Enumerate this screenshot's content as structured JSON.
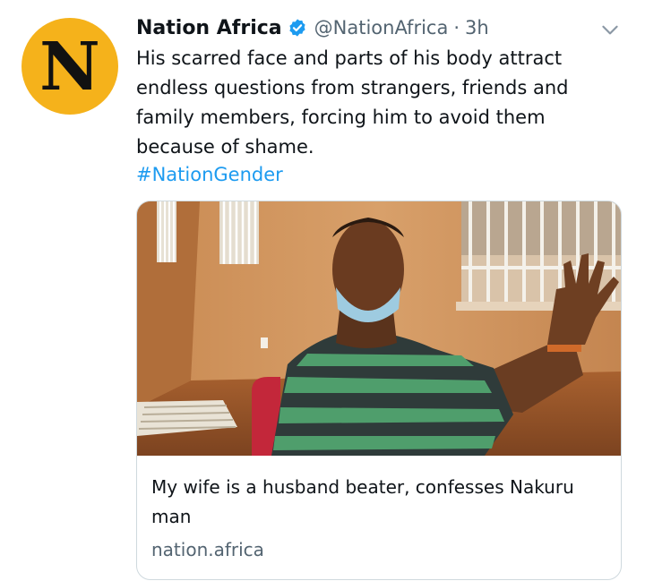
{
  "author": {
    "avatar_letter": "N",
    "display_name": "Nation Africa",
    "handle": "@NationAfrica",
    "separator": "·",
    "timestamp": "3h"
  },
  "tweet": {
    "text": "His scarred face and parts of his body attract endless questions from strangers, friends and family members, forcing him to avoid them because of shame.",
    "hashtag": "#NationGender"
  },
  "link_card": {
    "title": "My wife is a husband beater, confesses Nakuru man",
    "domain": "nation.africa"
  },
  "colors": {
    "avatar_bg": "#f5b21b",
    "verified_badge": "#1d9bf0",
    "hashtag": "#1d9bf0",
    "secondary_text": "#536471"
  },
  "icons": [
    "verified-badge-icon",
    "chevron-down-icon"
  ]
}
